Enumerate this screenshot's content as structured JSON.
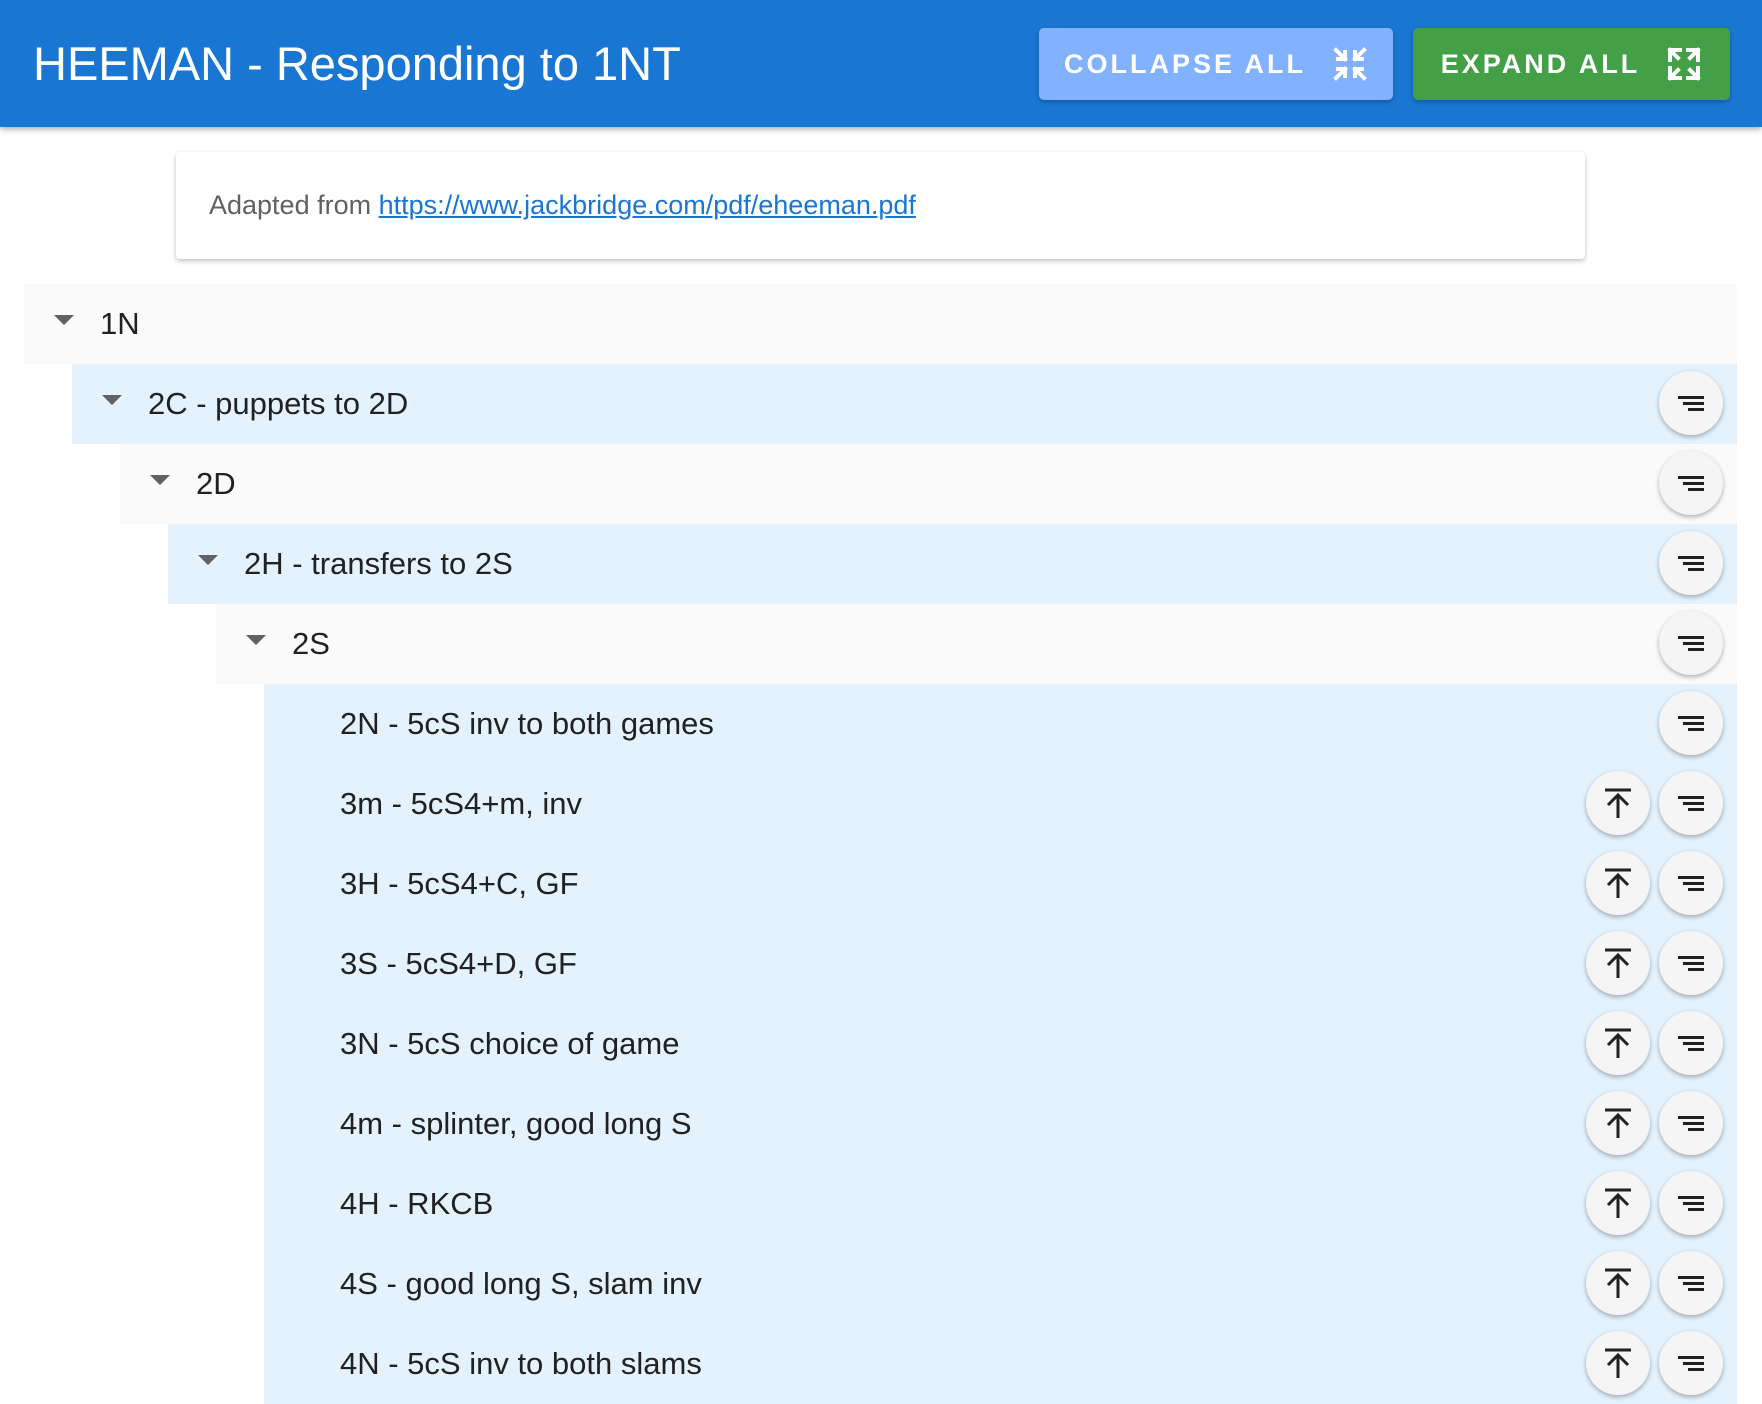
{
  "header": {
    "title": "HEEMAN - Responding to 1NT",
    "collapse_label": "COLLAPSE ALL",
    "expand_label": "EXPAND ALL",
    "color": "#1976d2"
  },
  "info": {
    "prefix": "Adapted from ",
    "link_text": "https://www.jackbridge.com/pdf/eheeman.pdf"
  },
  "tree": [
    {
      "label": "1N",
      "depth": 0,
      "expandable": true
    },
    {
      "label": "2C - puppets to 2D",
      "depth": 1,
      "expandable": true
    },
    {
      "label": "2D",
      "depth": 2,
      "expandable": true
    },
    {
      "label": "2H - transfers to 2S",
      "depth": 3,
      "expandable": true
    },
    {
      "label": "2S",
      "depth": 4,
      "expandable": true
    },
    {
      "label": "2N - 5cS inv to both games",
      "depth": 5,
      "expandable": false
    },
    {
      "label": "3m - 5cS4+m, inv",
      "depth": 5,
      "expandable": false
    },
    {
      "label": "3H - 5cS4+C, GF",
      "depth": 5,
      "expandable": false
    },
    {
      "label": "3S - 5cS4+D, GF",
      "depth": 5,
      "expandable": false
    },
    {
      "label": "3N - 5cS choice of game",
      "depth": 5,
      "expandable": false
    },
    {
      "label": "4m - splinter, good long S",
      "depth": 5,
      "expandable": false
    },
    {
      "label": "4H - RKCB",
      "depth": 5,
      "expandable": false
    },
    {
      "label": "4S - good long S, slam inv",
      "depth": 5,
      "expandable": false
    },
    {
      "label": "4N - 5cS inv to both slams",
      "depth": 5,
      "expandable": false
    }
  ],
  "icons": {
    "caret": "caret-down-icon",
    "menu": "sort-lines-icon",
    "top": "arrow-to-top-icon",
    "collapse": "collapse-arrows-icon",
    "expand": "expand-arrows-icon"
  },
  "colors": {
    "row_blue": "#e3f2fd",
    "row_grey": "#fafafa",
    "expand_button": "#43a047",
    "collapse_button": "#82b1ff"
  }
}
